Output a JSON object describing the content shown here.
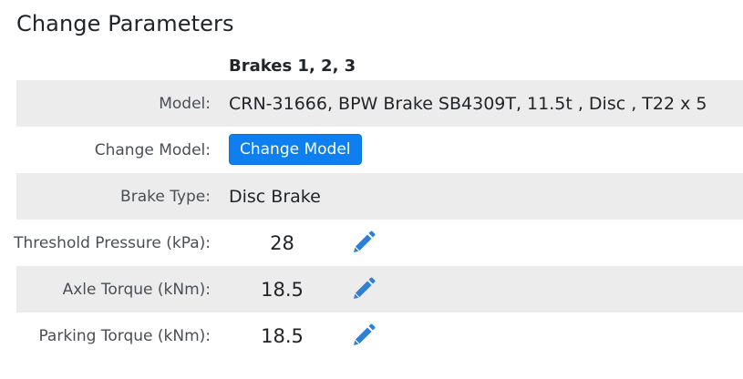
{
  "page": {
    "title": "Change Parameters"
  },
  "table": {
    "column_header": "Brakes 1, 2, 3",
    "rows": [
      {
        "label": "Model:",
        "value": "CRN-31666, BPW Brake SB4309T, 11.5t , Disc , T22 x 5"
      },
      {
        "label": "Change Model:",
        "button_label": "Change Model"
      },
      {
        "label": "Brake Type:",
        "value": "Disc Brake"
      },
      {
        "label": "Threshold Pressure (kPa):",
        "value": "28",
        "icon": "pencil-icon"
      },
      {
        "label": "Axle Torque (kNm):",
        "value": "18.5",
        "icon": "pencil-icon"
      },
      {
        "label": "Parking Torque (kNm):",
        "value": "18.5",
        "icon": "pencil-icon"
      }
    ]
  },
  "colors": {
    "accent": "#0d7ff0",
    "row_shade": "#ececec",
    "icon": "#2f7fd6"
  }
}
